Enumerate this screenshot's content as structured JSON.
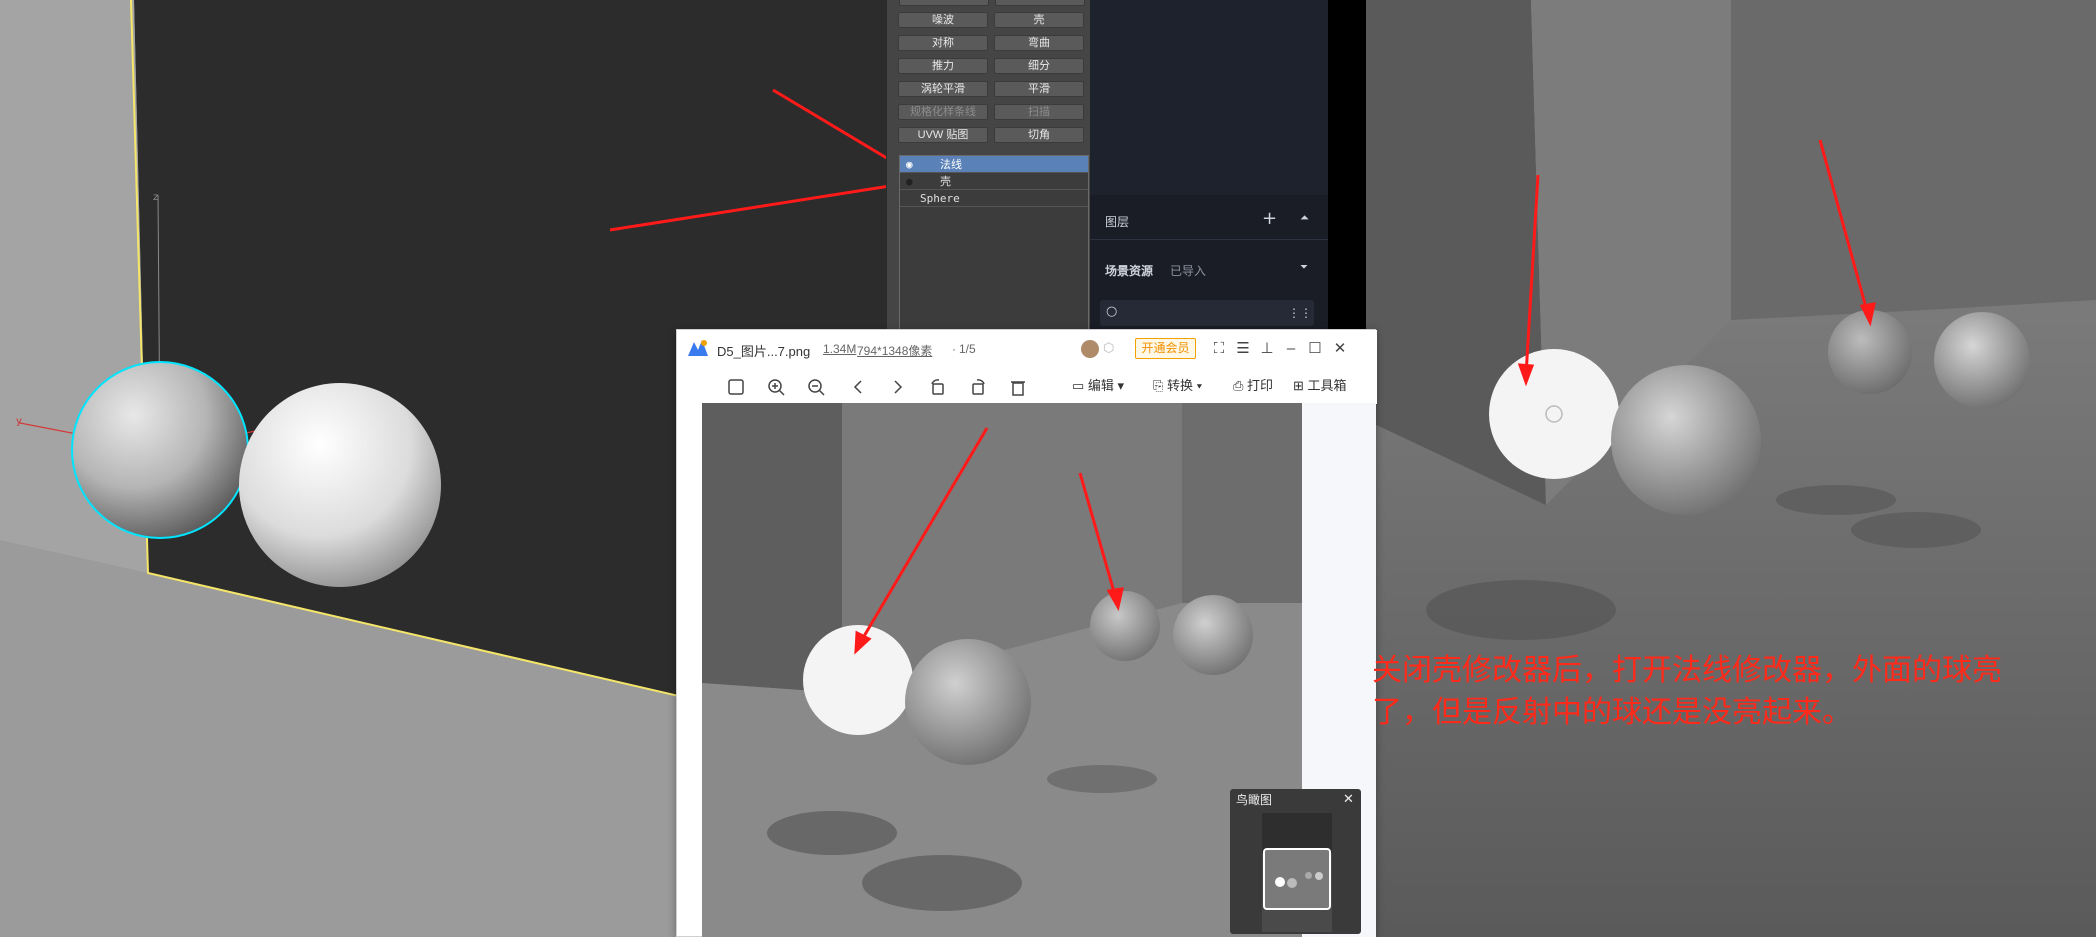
{
  "modifier_panel": {
    "buttons": [
      [
        "噪波",
        "壳"
      ],
      [
        "对称",
        "弯曲"
      ],
      [
        "推力",
        "细分"
      ],
      [
        "涡轮平滑",
        "平滑"
      ],
      [
        "规格化样条线",
        "扫描"
      ],
      [
        "UVW 贴图",
        "切角"
      ]
    ],
    "disabled_buttons": [
      "规格化样条线",
      "扫描"
    ],
    "stack": [
      {
        "label": "法线",
        "selected": true,
        "enabled": true
      },
      {
        "label": "壳",
        "selected": false,
        "enabled": false
      },
      {
        "label": "Sphere",
        "selected": false,
        "enabled": true
      }
    ]
  },
  "d5_panel": {
    "layers_label": "图层",
    "scene_assets_label": "场景资源",
    "imported_label": "已导入"
  },
  "viewer": {
    "filename": "D5_图片...7.png",
    "filesize": "1.34M",
    "dimensions": "794*1348像素",
    "page": "1/5",
    "vip_label": "开通会员",
    "tools": {
      "edit": "编辑",
      "convert": "转换",
      "print": "打印",
      "toolbox": "工具箱"
    },
    "birdseye_label": "鸟瞰图"
  },
  "annotation": "关闭壳修改器后，打开法线修改器，外面的球亮了，但是反射中的球还是没亮起来。",
  "colors": {
    "arrow": "#ff1a1a",
    "selection": "#5b82b8",
    "vip": "#f29100",
    "viewport_bg": "#2b2b2b",
    "object_highlight": "#00e5ff",
    "wall_outline": "#f5e66a"
  }
}
